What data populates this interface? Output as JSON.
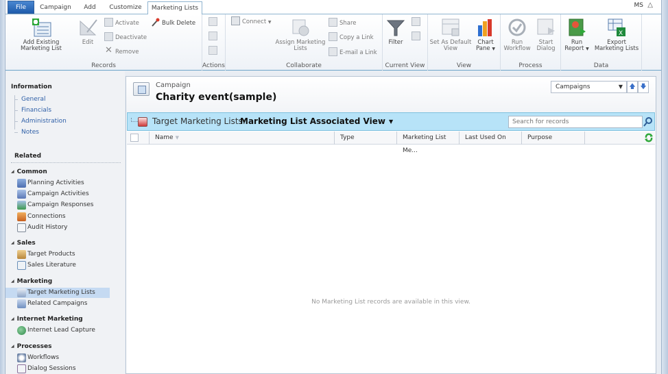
{
  "tabs": {
    "file": "File",
    "items": [
      "Campaign",
      "Add",
      "Customize",
      "Marketing Lists"
    ],
    "active": "Marketing Lists"
  },
  "user": {
    "initials": "MS",
    "collapse_icon": "chevron-up-icon"
  },
  "ribbon": {
    "groups": {
      "records": {
        "label": "Records",
        "add_existing": "Add Existing Marketing List",
        "edit": "Edit",
        "activate": "Activate",
        "deactivate": "Deactivate",
        "remove": "Remove",
        "bulk_delete": "Bulk Delete"
      },
      "actions": {
        "label": "Actions"
      },
      "collaborate": {
        "label": "Collaborate",
        "connect": "Connect",
        "assign": "Assign Marketing Lists",
        "share": "Share",
        "copy_link": "Copy a Link",
        "email_link": "E-mail a Link"
      },
      "current_view": {
        "label": "Current View",
        "filter": "Filter"
      },
      "view": {
        "label": "View",
        "set_default": "Set As Default View",
        "chart_pane": "Chart Pane"
      },
      "process": {
        "label": "Process",
        "run_workflow": "Run Workflow",
        "start_dialog": "Start Dialog"
      },
      "data": {
        "label": "Data",
        "run_report": "Run Report",
        "export": "Export Marketing Lists"
      }
    }
  },
  "nav": {
    "information_heading": "Information",
    "information_links": [
      "General",
      "Financials",
      "Administration",
      "Notes"
    ],
    "related_heading": "Related",
    "sections": [
      {
        "title": "Common",
        "items": [
          "Planning Activities",
          "Campaign Activities",
          "Campaign Responses",
          "Connections",
          "Audit History"
        ]
      },
      {
        "title": "Sales",
        "items": [
          "Target Products",
          "Sales Literature"
        ]
      },
      {
        "title": "Marketing",
        "items": [
          "Target Marketing Lists",
          "Related Campaigns"
        ]
      },
      {
        "title": "Internet Marketing",
        "items": [
          "Internet Lead Capture"
        ]
      },
      {
        "title": "Processes",
        "items": [
          "Workflows",
          "Dialog Sessions"
        ]
      }
    ],
    "selected": "Target Marketing Lists"
  },
  "record": {
    "entity": "Campaign",
    "title": "Charity event(sample)",
    "nav_select": "Campaigns"
  },
  "view": {
    "label": "Target Marketing Lists:",
    "name": "Marketing List Associated View",
    "search_placeholder": "Search for records",
    "columns": [
      "Name",
      "Type",
      "Marketing List Me...",
      "Last Used On",
      "Purpose"
    ],
    "empty_message": "No Marketing List records are available in this view."
  },
  "colors": {
    "file_tab": "#2563b8",
    "view_bar": "#b7e3f8",
    "nav_selected": "#c5daf2",
    "link": "#2e5fa7"
  }
}
